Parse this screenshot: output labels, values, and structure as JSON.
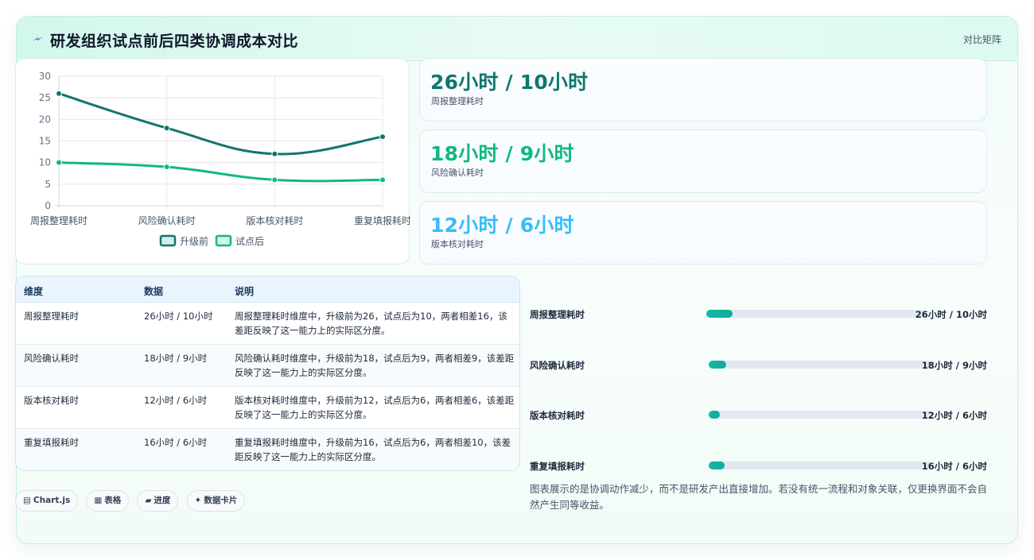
{
  "header": {
    "title": "研发组织试点前后四类协调成本对比",
    "badge": "对比矩阵",
    "icon": "bolt-icon"
  },
  "chart_data": {
    "type": "line",
    "categories": [
      "周报整理耗时",
      "风险确认耗时",
      "版本核对耗时",
      "重复填报耗时"
    ],
    "series": [
      {
        "name": "升级前",
        "values": [
          26,
          18,
          12,
          16
        ],
        "color": "#0f766e"
      },
      {
        "name": "试点后",
        "values": [
          10,
          9,
          6,
          6
        ],
        "color": "#10b981"
      }
    ],
    "ylim": [
      0,
      30
    ],
    "yticks": [
      "0",
      "5",
      "10",
      "15",
      "20",
      "25",
      "30"
    ],
    "grid": true,
    "legend": "bottom"
  },
  "stats": [
    {
      "value": "26小时 / 10小时",
      "label": "周报整理耗时",
      "color": "#0f766e"
    },
    {
      "value": "18小时 / 9小时",
      "label": "风险确认耗时",
      "color": "#10b981"
    },
    {
      "value": "12小时 / 6小时",
      "label": "版本核对耗时",
      "color": "#38bdf8"
    }
  ],
  "table": {
    "headers": [
      "维度",
      "数据",
      "说明"
    ],
    "rows": [
      {
        "dim": "周报整理耗时",
        "data": "26小时 / 10小时",
        "desc": "周报整理耗时维度中，升级前为26，试点后为10，两者相差16，该差距反映了这一能力上的实际区分度。"
      },
      {
        "dim": "风险确认耗时",
        "data": "18小时 / 9小时",
        "desc": "风险确认耗时维度中，升级前为18，试点后为9，两者相差9，该差距反映了这一能力上的实际区分度。"
      },
      {
        "dim": "版本核对耗时",
        "data": "12小时 / 6小时",
        "desc": "版本核对耗时维度中，升级前为12，试点后为6，两者相差6，该差距反映了这一能力上的实际区分度。"
      },
      {
        "dim": "重复填报耗时",
        "data": "16小时 / 6小时",
        "desc": "重复填报耗时维度中，升级前为16，试点后为6，两者相差10，该差距反映了这一能力上的实际区分度。"
      }
    ]
  },
  "progress": [
    {
      "label": "周报整理耗时",
      "value": "26小时 / 10小时",
      "fraction": 0.12
    },
    {
      "label": "风险确认耗时",
      "value": "18小时 / 9小时",
      "fraction": 0.08
    },
    {
      "label": "版本核对耗时",
      "value": "12小时 / 6小时",
      "fraction": 0.05
    },
    {
      "label": "重复填报耗时",
      "value": "16小时 / 6小时",
      "fraction": 0.07
    }
  ],
  "note": "图表展示的是协调动作减少，而不是研发产出直接增加。若没有统一流程和对象关联，仅更换界面不会自然产生同等收益。",
  "chips": [
    {
      "icon": "▤",
      "label": "Chart.js"
    },
    {
      "icon": "▦",
      "label": "表格"
    },
    {
      "icon": "▰",
      "label": "进度"
    },
    {
      "icon": "✦",
      "label": "数据卡片"
    }
  ]
}
